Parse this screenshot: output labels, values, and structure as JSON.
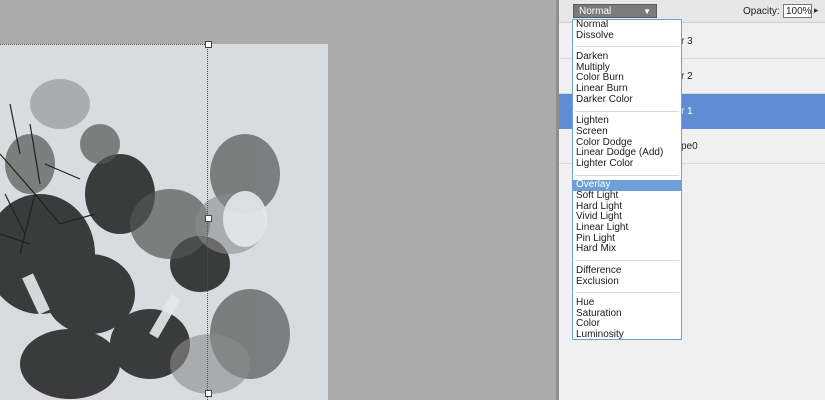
{
  "toolbar": {
    "blend_mode_value": "Normal",
    "opacity_label": "Opacity:",
    "opacity_value": "100%"
  },
  "layers": [
    {
      "name": "r 3",
      "selected": false
    },
    {
      "name": "r 2",
      "selected": false
    },
    {
      "name": "r 1",
      "selected": true
    },
    {
      "name": "pe0",
      "selected": false
    }
  ],
  "blend_menu": {
    "groups": [
      [
        "Normal",
        "Dissolve"
      ],
      [
        "Darken",
        "Multiply",
        "Color Burn",
        "Linear Burn",
        "Darker Color"
      ],
      [
        "Lighten",
        "Screen",
        "Color Dodge",
        "Linear Dodge (Add)",
        "Lighter Color"
      ],
      [
        "Overlay",
        "Soft Light",
        "Hard Light",
        "Vivid Light",
        "Linear Light",
        "Pin Light",
        "Hard Mix"
      ],
      [
        "Difference",
        "Exclusion"
      ],
      [
        "Hue",
        "Saturation",
        "Color",
        "Luminosity"
      ]
    ],
    "highlighted": "Overlay"
  },
  "colors": {
    "selection_blue": "#5f8dd3",
    "menu_highlight": "#6f9fd8"
  }
}
